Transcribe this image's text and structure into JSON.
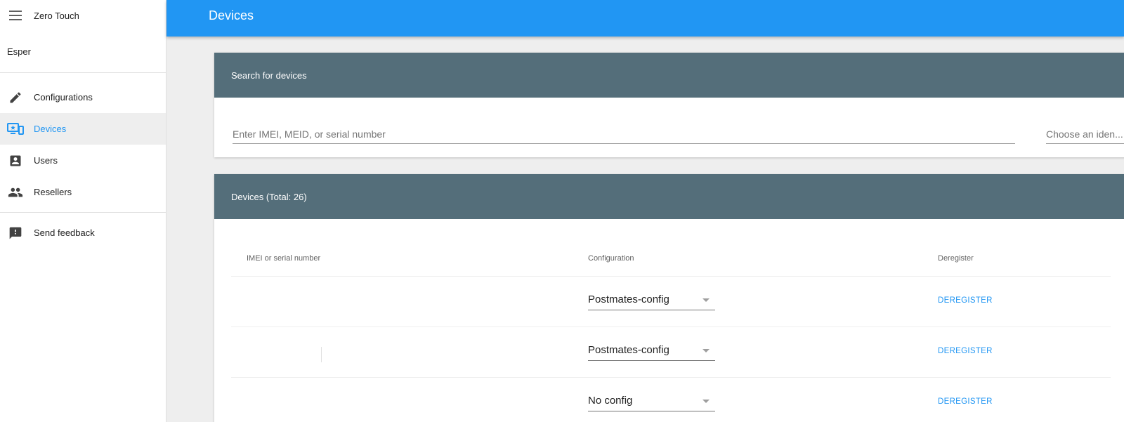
{
  "sidebar": {
    "app_title": "Zero Touch",
    "org_name": "Esper",
    "items": [
      {
        "label": "Configurations",
        "icon": "pencil-icon",
        "active": false
      },
      {
        "label": "Devices",
        "icon": "devices-icon",
        "active": true
      },
      {
        "label": "Users",
        "icon": "user-icon",
        "active": false
      },
      {
        "label": "Resellers",
        "icon": "people-icon",
        "active": false
      }
    ],
    "feedback_label": "Send feedback"
  },
  "appbar": {
    "title": "Devices"
  },
  "search": {
    "header": "Search for devices",
    "placeholder": "Enter IMEI, MEID, or serial number",
    "identifier_placeholder": "Choose an iden..."
  },
  "devices": {
    "header": "Devices (Total: 26)",
    "columns": [
      "IMEI or serial number",
      "Configuration",
      "Deregister"
    ],
    "rows": [
      {
        "imei": "",
        "config": "Postmates-config",
        "action": "DEREGISTER"
      },
      {
        "imei": "",
        "config": "Postmates-config",
        "action": "DEREGISTER"
      },
      {
        "imei": "",
        "config": "No config",
        "action": "DEREGISTER"
      }
    ]
  },
  "colors": {
    "primary": "#2196f3",
    "card_header": "#546e7a",
    "background": "#eeeeee"
  }
}
